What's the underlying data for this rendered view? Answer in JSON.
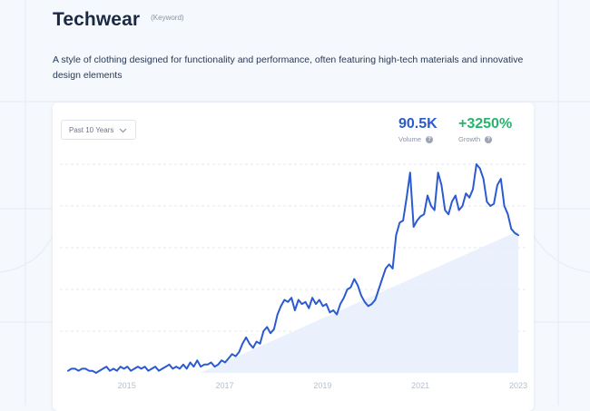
{
  "header": {
    "title": "Techwear",
    "type_label": "(Keyword)"
  },
  "description": "A style of clothing designed for functionality and performance, often featuring high-tech materials and innovative design elements",
  "card": {
    "range_select": {
      "value": "Past 10 Years"
    },
    "volume": {
      "value": "90.5K",
      "label": "Volume"
    },
    "growth": {
      "value": "+3250%",
      "label": "Growth"
    }
  },
  "colors": {
    "line": "#2b5ad1",
    "growth": "#27b46d",
    "trend_fill": "#e6eefb"
  },
  "chart_data": {
    "type": "line",
    "x_start_year": 2013.8,
    "x_end_year": 2023.0,
    "x_ticks": [
      "2015",
      "2017",
      "2019",
      "2021",
      "2023"
    ],
    "x_tick_years": [
      2015,
      2017,
      2019,
      2021,
      2023
    ],
    "y_range": [
      0,
      100
    ],
    "grid": "horizontal dashed",
    "trend": {
      "from": [
        2016.5,
        0
      ],
      "to": [
        2023.0,
        68
      ]
    },
    "values": [
      1,
      2,
      2,
      1,
      2,
      2,
      1,
      1,
      0,
      1,
      2,
      3,
      1,
      2,
      1,
      3,
      2,
      3,
      1,
      2,
      3,
      2,
      3,
      1,
      2,
      3,
      1,
      2,
      3,
      4,
      2,
      3,
      2,
      4,
      2,
      5,
      3,
      6,
      3,
      4,
      4,
      5,
      3,
      4,
      6,
      5,
      7,
      9,
      8,
      10,
      14,
      17,
      14,
      12,
      15,
      14,
      20,
      22,
      19,
      21,
      28,
      32,
      35,
      34,
      36,
      30,
      35,
      33,
      34,
      31,
      36,
      33,
      35,
      32,
      33,
      29,
      30,
      28,
      33,
      36,
      40,
      41,
      45,
      42,
      37,
      34,
      32,
      33,
      35,
      40,
      45,
      50,
      52,
      50,
      66,
      72,
      73,
      84,
      96,
      70,
      73,
      75,
      76,
      85,
      80,
      78,
      96,
      90,
      78,
      76,
      82,
      85,
      78,
      80,
      86,
      84,
      88,
      100,
      98,
      93,
      82,
      80,
      81,
      90,
      93,
      80,
      76,
      69,
      67,
      66
    ]
  }
}
